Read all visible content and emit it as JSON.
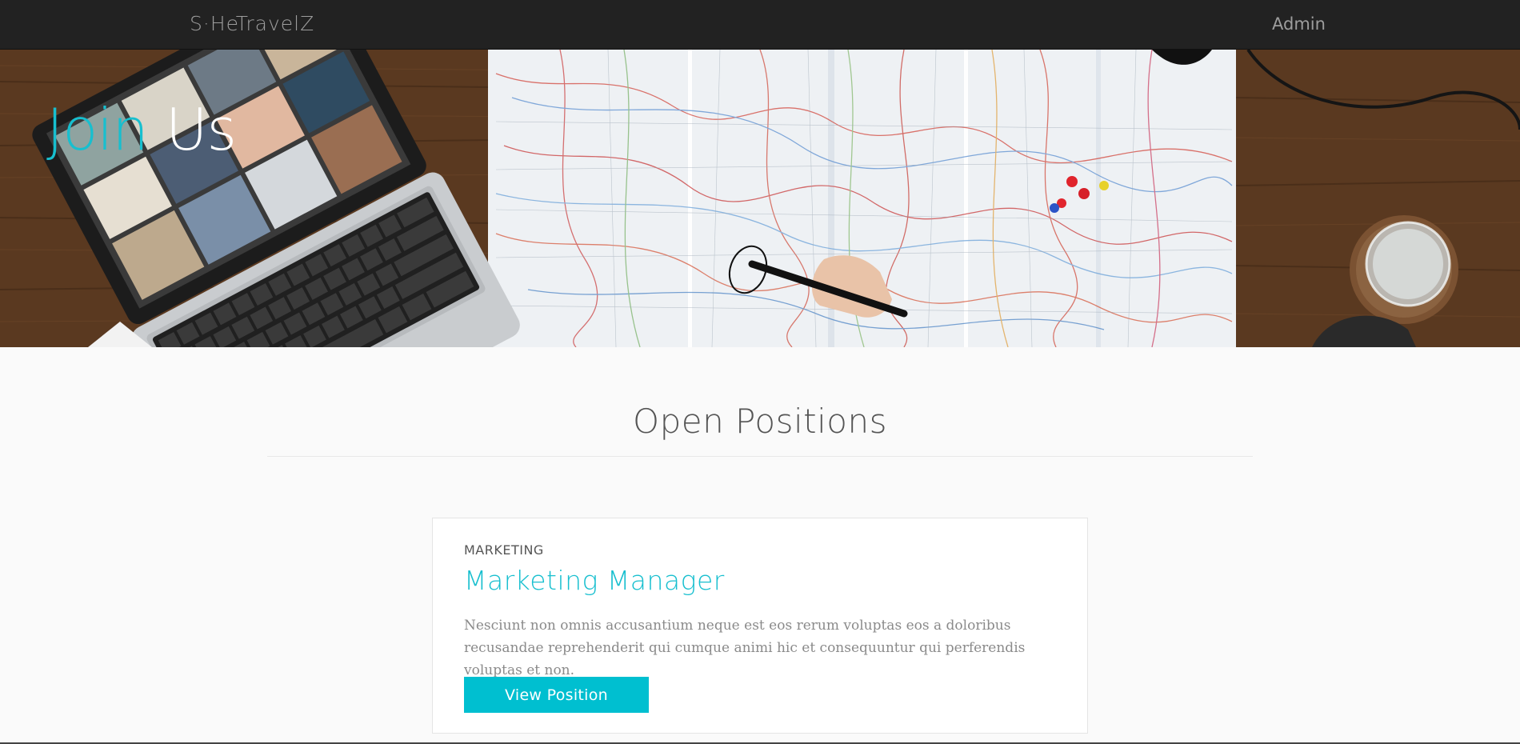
{
  "navbar": {
    "brand": "S·HeTravelZ",
    "admin_link": "Admin"
  },
  "hero": {
    "title_word_1": "Join",
    "title_word_2": "Us",
    "image_icon": "laptop-map-desk-photo"
  },
  "section": {
    "title": "Open Positions"
  },
  "positions": [
    {
      "category": "MARKETING",
      "title": "Marketing Manager",
      "description": "Nesciunt non omnis accusantium neque est eos rerum voluptas eos a doloribus recusandae reprehenderit qui cumque animi hic et consequuntur qui perferendis voluptas et non.",
      "button_label": "View Position"
    }
  ],
  "colors": {
    "accent": "#00bfd0",
    "navbar_bg": "#222222",
    "page_bg": "#fafafa"
  }
}
